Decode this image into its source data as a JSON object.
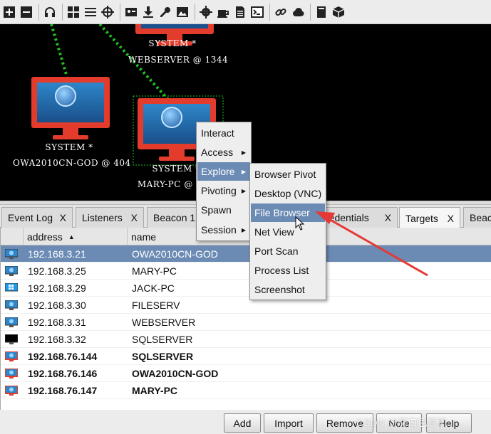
{
  "toolbar": {
    "icons": [
      "plus-icon",
      "minus-icon",
      "headphones-icon",
      "graph-view-icon",
      "list-view-icon",
      "crosshair-icon",
      "id-card-icon",
      "download-icon",
      "key-icon",
      "image-icon",
      "gear-icon",
      "coffee-icon",
      "document-icon",
      "terminal-icon",
      "link-icon",
      "cloud-icon",
      "book-icon",
      "package-icon"
    ]
  },
  "graph": {
    "hosts": [
      {
        "label1": "SYSTEM *",
        "label2": "WEBSERVER @ 1344"
      },
      {
        "label1": "SYSTEM *",
        "label2": "OWA2010CN-GOD @ 404"
      },
      {
        "label1": "SYSTEM *",
        "label2": "MARY-PC @ 1"
      }
    ]
  },
  "tabs": [
    {
      "label": "Event Log",
      "close": "X"
    },
    {
      "label": "Listeners",
      "close": "X"
    },
    {
      "label": "Beacon 1",
      "close": "X"
    },
    {
      "label": "redentials",
      "close": "X"
    },
    {
      "label": "Targets",
      "close": "X"
    },
    {
      "label": "Beac",
      "close": ""
    }
  ],
  "table": {
    "columns": [
      "address",
      "name"
    ],
    "sort_indicator": "▲",
    "rows": [
      {
        "address": "192.168.3.21",
        "name": "OWA2010CN-GOD"
      },
      {
        "address": "192.168.3.25",
        "name": "MARY-PC"
      },
      {
        "address": "192.168.3.29",
        "name": "JACK-PC"
      },
      {
        "address": "192.168.3.30",
        "name": "FILESERV"
      },
      {
        "address": "192.168.3.31",
        "name": "WEBSERVER"
      },
      {
        "address": "192.168.3.32",
        "name": "SQLSERVER"
      },
      {
        "address": "192.168.76.144",
        "name": "SQLSERVER"
      },
      {
        "address": "192.168.76.146",
        "name": "OWA2010CN-GOD"
      },
      {
        "address": "192.168.76.147",
        "name": "MARY-PC"
      }
    ]
  },
  "context_menu": {
    "items": [
      "Interact",
      "Access",
      "Explore",
      "Pivoting",
      "Spawn",
      "Session"
    ]
  },
  "explore_submenu": {
    "items": [
      "Browser Pivot",
      "Desktop (VNC)",
      "File Browser",
      "Net View",
      "Port Scan",
      "Process List",
      "Screenshot"
    ]
  },
  "buttons": [
    "Add",
    "Import",
    "Remove",
    "Note",
    "Help"
  ],
  "watermark": "CSDN @深白色耳机",
  "colors": {
    "selection": "#6b8bb4",
    "host_red": "#e33b2c",
    "beacon_link": "#22c322",
    "annotation_arrow": "#e53935"
  }
}
